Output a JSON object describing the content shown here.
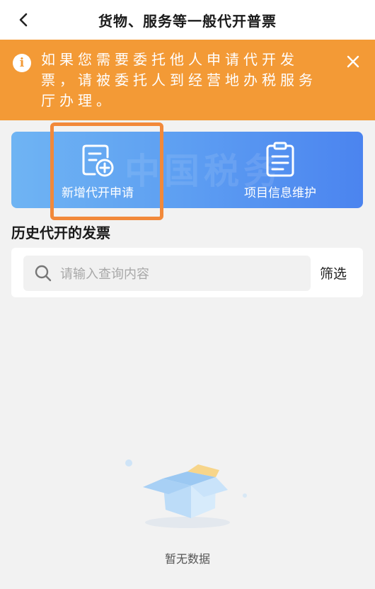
{
  "header": {
    "title": "货物、服务等一般代开普票"
  },
  "notice": {
    "text": "如果您需要委托他人申请代开发票，请被委托人到经营地办税服务厅办理。",
    "icon": "info-icon"
  },
  "actions": {
    "watermark": "中国税务",
    "new_application": {
      "label": "新增代开申请",
      "icon": "add-document-icon"
    },
    "project_info": {
      "label": "项目信息维护",
      "icon": "clipboard-icon"
    }
  },
  "history": {
    "title": "历史代开的发票",
    "search_placeholder": "请输入查询内容",
    "filter_label": "筛选"
  },
  "empty": {
    "text": "暂无数据"
  },
  "colors": {
    "notice_bg": "#f39a36",
    "panel_start": "#6fb4f3",
    "panel_end": "#4b84ef",
    "highlight": "#f2893a"
  }
}
